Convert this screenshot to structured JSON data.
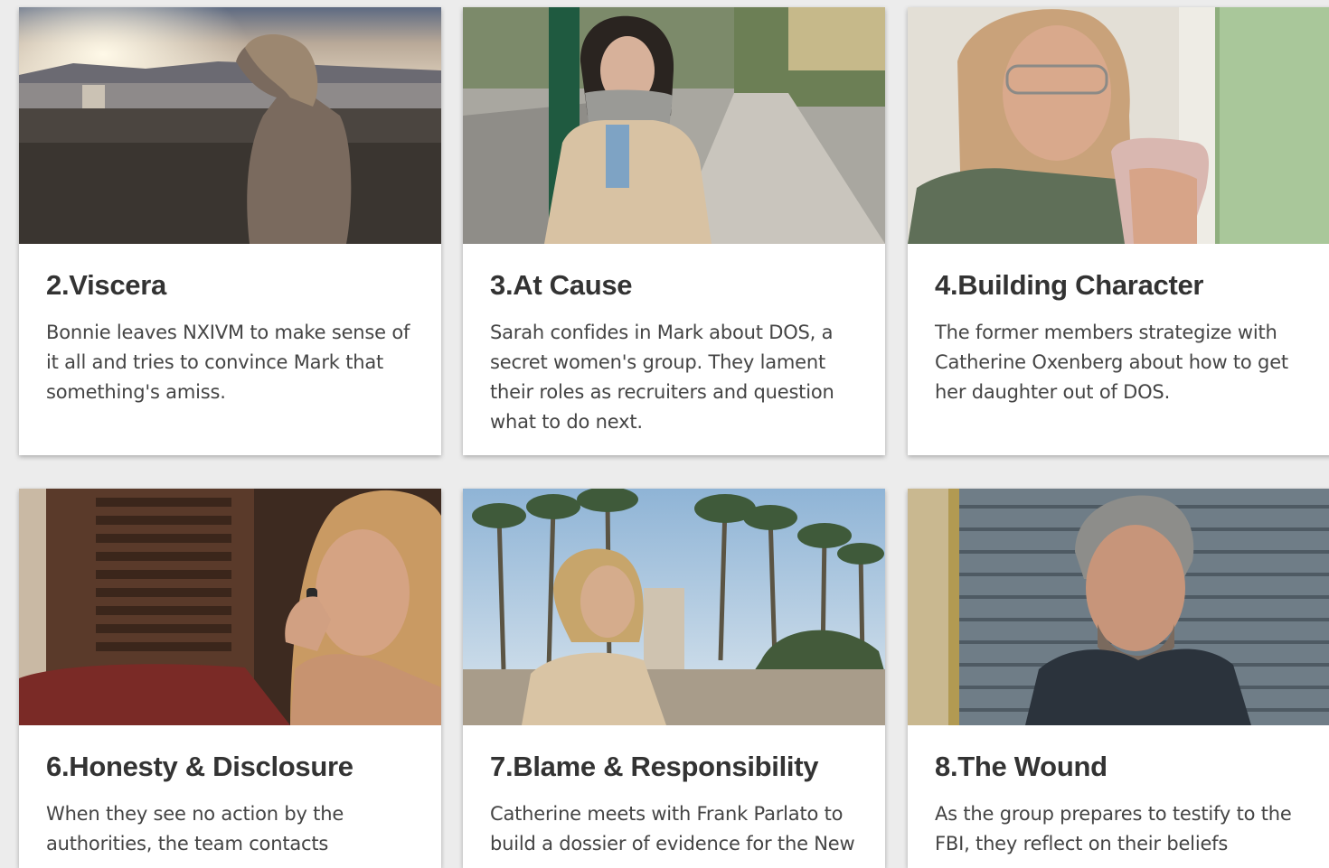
{
  "episodes": [
    {
      "title": "2.Viscera",
      "description": "Bonnie leaves NXIVM to make sense of it all and tries to convince Mark that something's amiss.",
      "image": "woman-walking-on-beach-at-sunset"
    },
    {
      "title": "3.At Cause",
      "description": "Sarah confides in Mark about DOS, a secret women's group. They lament their roles as recruiters and question what to do next.",
      "image": "woman-in-scarf-on-sidewalk"
    },
    {
      "title": "4.Building Character",
      "description": "The former members strategize with Catherine Oxenberg about how to get her daughter out of DOS.",
      "image": "woman-with-glasses-looking-at-phone"
    },
    {
      "title": "6.Honesty & Disclosure",
      "description": "When they see no action by the authorities, the team contacts",
      "image": "woman-on-phone-call"
    },
    {
      "title": "7.Blame & Responsibility",
      "description": "Catherine meets with Frank Parlato to build a dossier of evidence for the New",
      "image": "woman-among-palm-trees"
    },
    {
      "title": "8.The Wound",
      "description": "As the group prepares to testify to the FBI, they reflect on their beliefs",
      "image": "man-in-jacket-by-metal-wall"
    }
  ]
}
